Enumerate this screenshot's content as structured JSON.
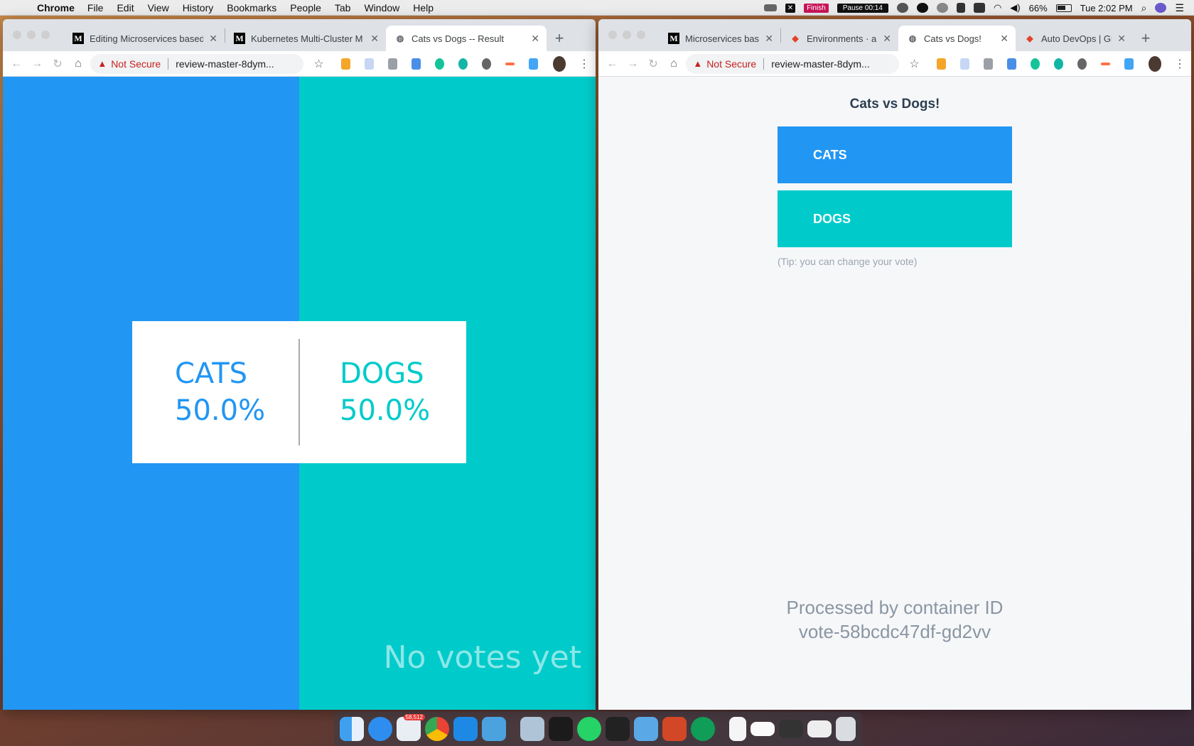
{
  "menubar": {
    "app_name": "Chrome",
    "menus": [
      "File",
      "Edit",
      "View",
      "History",
      "Bookmarks",
      "People",
      "Tab",
      "Window",
      "Help"
    ],
    "recorder": {
      "x": "✕",
      "finish": "Finish",
      "pause": "Pause 00:14"
    },
    "battery": "66%",
    "battery_level": 0.66,
    "clock": "Tue 2:02 PM"
  },
  "left_window": {
    "tabs": [
      {
        "title": "Editing Microservices based",
        "favicon": "medium-icon"
      },
      {
        "title": "Kubernetes Multi-Cluster M",
        "favicon": "medium-icon"
      },
      {
        "title": "Cats vs Dogs -- Result",
        "favicon": "globe-icon"
      }
    ],
    "address": {
      "security": "Not Secure",
      "url": "review-master-8dym..."
    },
    "page": {
      "cats_label": "CATS",
      "cats_percent": "50.0%",
      "dogs_label": "DOGS",
      "dogs_percent": "50.0%",
      "status": "No votes yet",
      "cats_color": "#2196f3",
      "dogs_color": "#00cbca"
    }
  },
  "right_window": {
    "tabs": [
      {
        "title": "Microservices bas",
        "favicon": "medium-icon"
      },
      {
        "title": "Environments · an",
        "favicon": "gitlab-icon"
      },
      {
        "title": "Cats vs Dogs!",
        "favicon": "globe-icon"
      },
      {
        "title": "Auto DevOps | Git",
        "favicon": "gitlab-icon"
      }
    ],
    "address": {
      "security": "Not Secure",
      "url": "review-master-8dym..."
    },
    "page": {
      "title": "Cats vs Dogs!",
      "cats_button": "CATS",
      "dogs_button": "DOGS",
      "tip": "(Tip: you can change your vote)",
      "processed_line1": "Processed by container ID",
      "processed_line2": "vote-58bcdc47df-gd2vv"
    }
  },
  "dock": {
    "badge": "58,512"
  }
}
